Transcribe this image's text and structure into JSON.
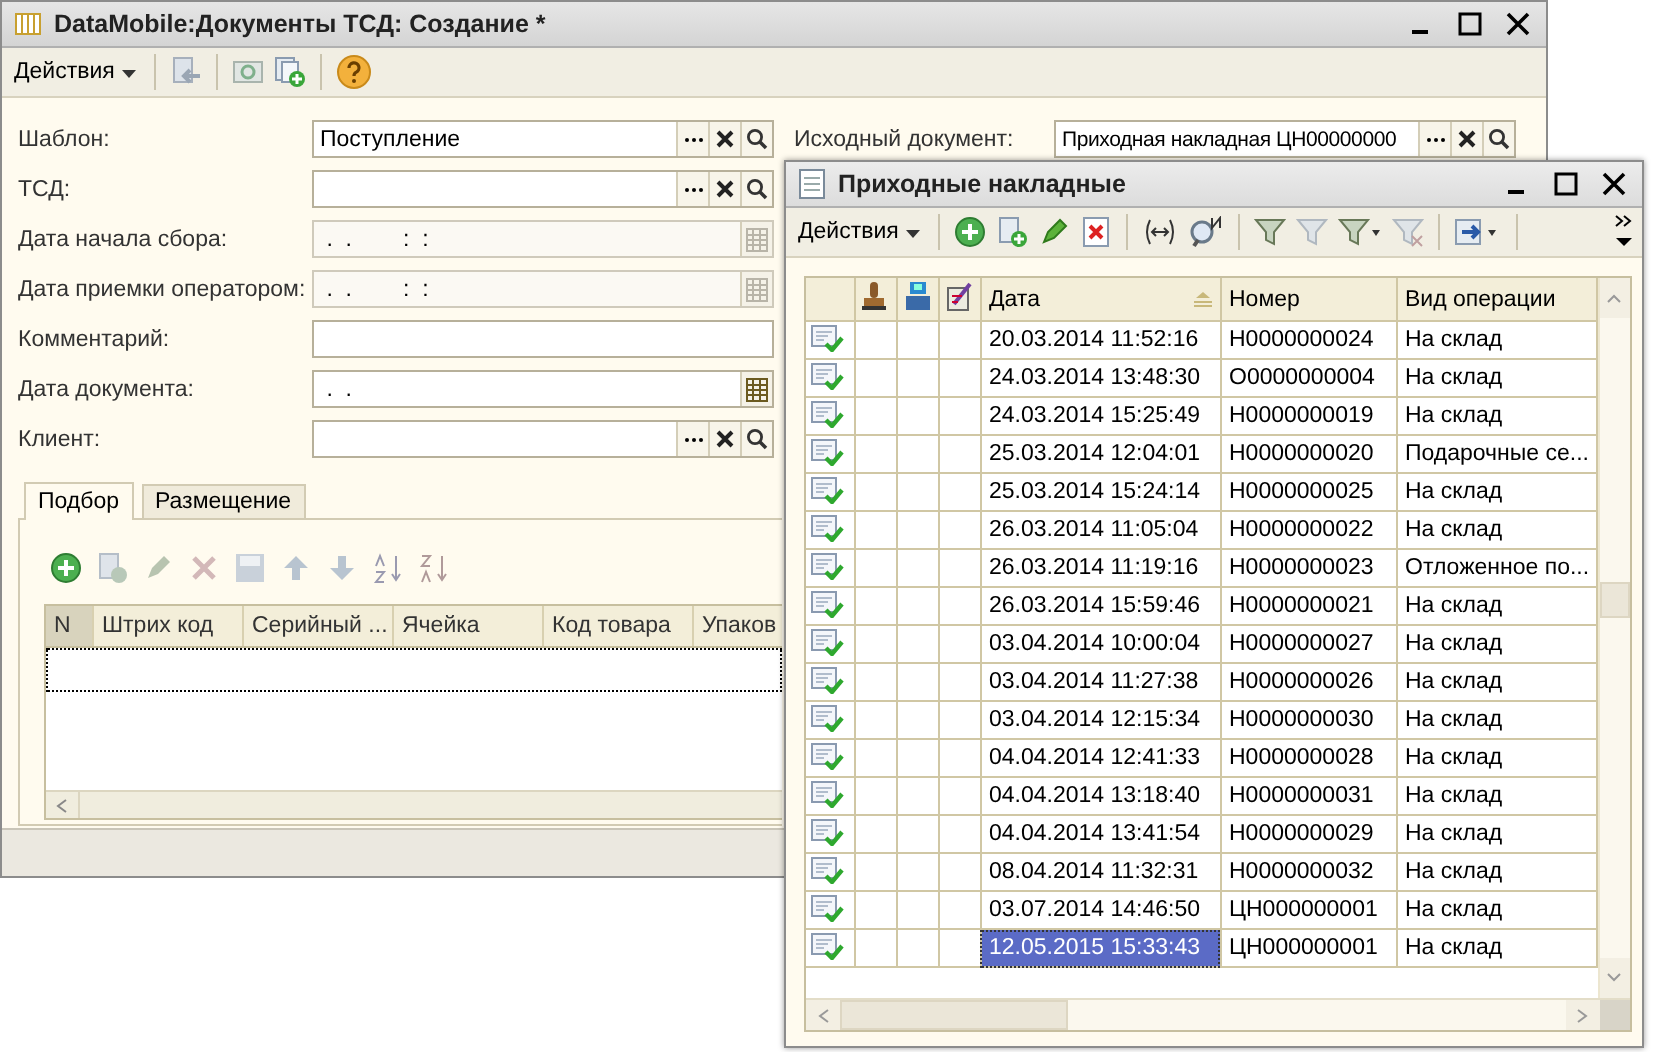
{
  "back_window": {
    "title": "DataMobile:Документы ТСД: Создание *",
    "actions_menu": "Действия",
    "fields": [
      {
        "label": "Шаблон:",
        "kind": "choice",
        "value": "Поступление",
        "disabled": false
      },
      {
        "label": "ТСД:",
        "kind": "choice",
        "disabled": false
      },
      {
        "label": "Дата начала сбора:",
        "kind": "date",
        "value": " .  .        :  :",
        "disabled": true
      },
      {
        "label": "Дата приемки оператором:",
        "kind": "date",
        "value": " .  .        :  :",
        "disabled": true
      },
      {
        "label": "Комментарий:",
        "kind": "text",
        "disabled": false
      },
      {
        "label": "Дата документа:",
        "kind": "date",
        "value": " .  .",
        "disabled": false
      },
      {
        "label": "Клиент:",
        "kind": "choice",
        "disabled": false
      }
    ],
    "source_document": {
      "label": "Исходный документ:",
      "value": "Приходная накладная ЦН00000000"
    },
    "tabs": [
      {
        "label": "Подбор",
        "selected": true
      },
      {
        "label": "Размещение",
        "selected": false
      }
    ],
    "table": {
      "columns": [
        "N",
        "Штрих код",
        "Серийный ...",
        "Ячейка",
        "Код товара",
        "Упаков"
      ]
    }
  },
  "front_window": {
    "title": "Приходные накладные",
    "actions_menu": "Действия",
    "table": {
      "columns": [
        "Дата",
        "Номер",
        "Вид операции"
      ],
      "rows": [
        {
          "date": "20.03.2014 11:52:16",
          "number": "Н0000000024",
          "operation": "На склад",
          "selected": false
        },
        {
          "date": "24.03.2014 13:48:30",
          "number": "О0000000004",
          "operation": "На склад",
          "selected": false
        },
        {
          "date": "24.03.2014 15:25:49",
          "number": "Н0000000019",
          "operation": "На склад",
          "selected": false
        },
        {
          "date": "25.03.2014 12:04:01",
          "number": "Н0000000020",
          "operation": "Подарочные се...",
          "selected": false
        },
        {
          "date": "25.03.2014 15:24:14",
          "number": "Н0000000025",
          "operation": "На склад",
          "selected": false
        },
        {
          "date": "26.03.2014 11:05:04",
          "number": "Н0000000022",
          "operation": "На склад",
          "selected": false
        },
        {
          "date": "26.03.2014 11:19:16",
          "number": "Н0000000023",
          "operation": "Отложенное по...",
          "selected": false
        },
        {
          "date": "26.03.2014 15:59:46",
          "number": "Н0000000021",
          "operation": "На склад",
          "selected": false
        },
        {
          "date": "03.04.2014 10:00:04",
          "number": "Н0000000027",
          "operation": "На склад",
          "selected": false
        },
        {
          "date": "03.04.2014 11:27:38",
          "number": "Н0000000026",
          "operation": "На склад",
          "selected": false
        },
        {
          "date": "03.04.2014 12:15:34",
          "number": "Н0000000030",
          "operation": "На склад",
          "selected": false
        },
        {
          "date": "04.04.2014 12:41:33",
          "number": "Н0000000028",
          "operation": "На склад",
          "selected": false
        },
        {
          "date": "04.04.2014 13:18:40",
          "number": "Н0000000031",
          "operation": "На склад",
          "selected": false
        },
        {
          "date": "04.04.2014 13:41:54",
          "number": "Н0000000029",
          "operation": "На склад",
          "selected": false
        },
        {
          "date": "08.04.2014 11:32:31",
          "number": "Н0000000032",
          "operation": "На склад",
          "selected": false
        },
        {
          "date": "03.07.2014 14:46:50",
          "number": "ЦН000000001",
          "operation": "На склад",
          "selected": false
        },
        {
          "date": "12.05.2015 15:33:43",
          "number": "ЦН000000001",
          "operation": "На склад",
          "selected": true
        }
      ]
    }
  }
}
